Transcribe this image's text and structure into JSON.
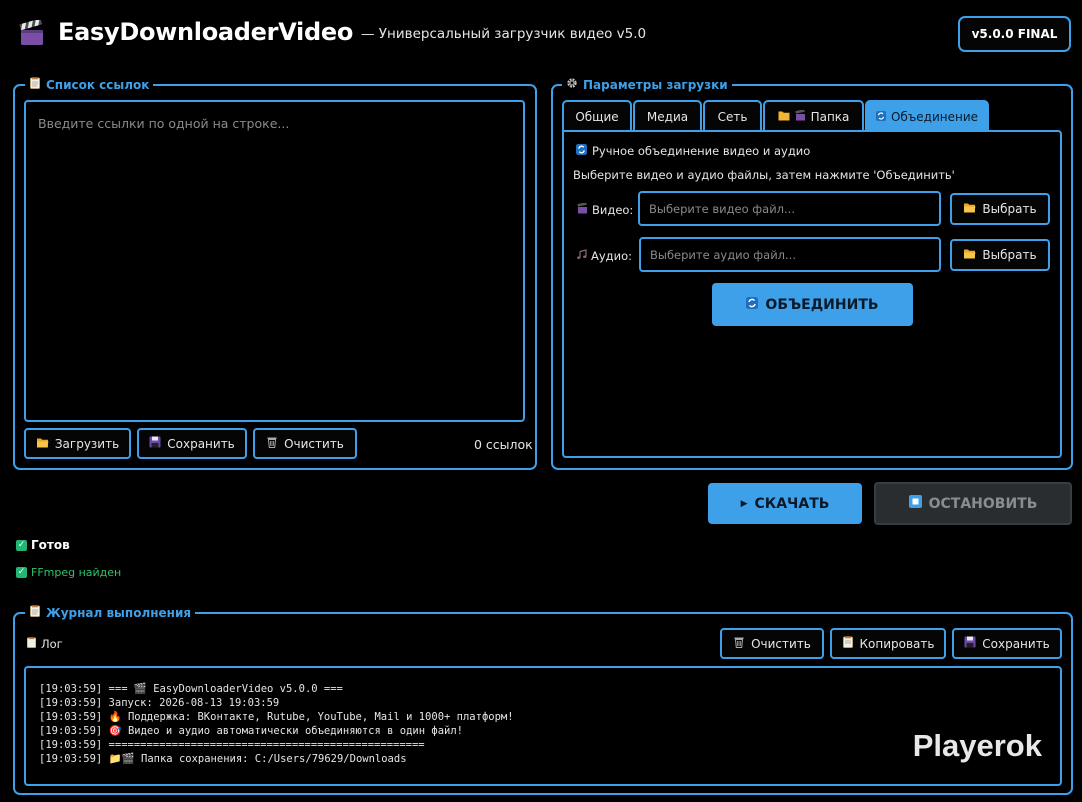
{
  "header": {
    "app_icon": "clapperboard-icon",
    "title": "EasyDownloaderVideo",
    "subtitle": "— Универсальный загрузчик видео v5.0",
    "version": "v5.0.0 FINAL"
  },
  "links_panel": {
    "title": "Список ссылок",
    "placeholder": "Введите ссылки по одной на строке...",
    "load_label": "Загрузить",
    "save_label": "Сохранить",
    "clear_label": "Очистить",
    "count": "0 ссылок"
  },
  "params_panel": {
    "title": "Параметры загрузки",
    "tabs": [
      {
        "label": "Общие"
      },
      {
        "label": "Медиа"
      },
      {
        "label": "Сеть"
      },
      {
        "label": "Папка"
      },
      {
        "label": "Объединение",
        "active": true
      }
    ],
    "merge": {
      "heading": "Ручное объединение видео и аудио",
      "instruction": "Выберите видео и аудио файлы, затем нажмите 'Объединить'",
      "video_label": "Видео:",
      "video_placeholder": "Выберите видео файл...",
      "audio_label": "Аудио:",
      "audio_placeholder": "Выберите аудио файл...",
      "choose_label": "Выбрать",
      "merge_label": "ОБЪЕДИНИТЬ"
    }
  },
  "actions": {
    "download_label": "СКАЧАТЬ",
    "stop_label": "ОСТАНОВИТЬ"
  },
  "status": {
    "ready": "Готов",
    "ffmpeg": "FFmpeg найден"
  },
  "log_panel": {
    "title": "Журнал выполнения",
    "log_label": "Лог",
    "clear_label": "Очистить",
    "copy_label": "Копировать",
    "save_label": "Сохранить",
    "lines": [
      {
        "time": "[19:03:59]",
        "text": "=== 🎬 EasyDownloaderVideo v5.0.0 ==="
      },
      {
        "time": "[19:03:59]",
        "text": "Запуск: 2026-08-13 19:03:59"
      },
      {
        "time": "[19:03:59]",
        "text": "🔥 Поддержка: ВКонтакте, Rutube, YouTube, Mail и 1000+ платформ!"
      },
      {
        "time": "[19:03:59]",
        "text": "🎯 Видео и аудио автоматически объединяются в один файл!"
      },
      {
        "time": "[19:03:59]",
        "text": "=================================================="
      },
      {
        "time": "[19:03:59]",
        "text": "📁🎬 Папка сохранения: C:/Users/79629/Downloads"
      }
    ],
    "watermark": "Playerok"
  },
  "colors": {
    "accent": "#3ea0e8",
    "background": "#000000",
    "success": "#22b573",
    "disabled_bg": "#2a2d30"
  }
}
